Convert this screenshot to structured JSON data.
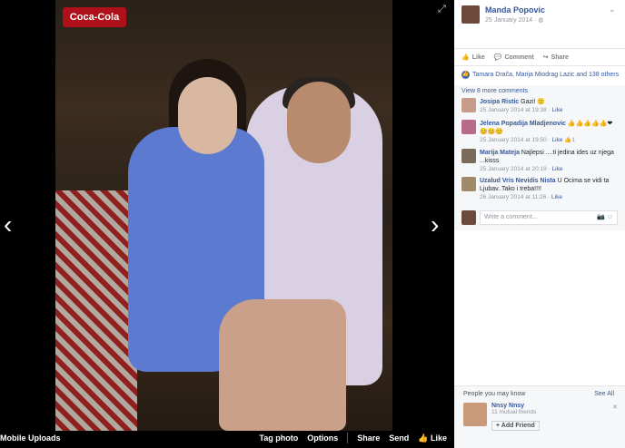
{
  "photo": {
    "sign_text": "Coca-Cola",
    "album": "Mobile Uploads",
    "actions": [
      "Tag photo",
      "Options",
      "Share",
      "Send",
      "Like"
    ]
  },
  "post": {
    "owner": "Manda Popovic",
    "date": "25 January 2014 ·",
    "like": "Like",
    "comment": "Comment",
    "share": "Share",
    "reactions": "Tamara Drača, Marija Miodrag Lazic and 138 others"
  },
  "comments": {
    "view_more": "View 8 more comments",
    "items": [
      {
        "name": "Josipa Ristic",
        "text": "Gazi! 🙂",
        "meta": "25 January 2014 at 19:38 · ",
        "like": "Like",
        "extra": ""
      },
      {
        "name": "Jelena Popadija Mladjenovic",
        "text": "👍👍👍👍👍❤😊😊😊",
        "meta": "25 January 2014 at 19:50 · ",
        "like": "Like",
        "extra": "1"
      },
      {
        "name": "Marija Mateja",
        "text": "Najlepsi ....ti jedina ides uz njega ...kisss",
        "meta": "25 January 2014 at 20:19 · ",
        "like": "Like",
        "extra": ""
      },
      {
        "name": "Uzalud Vris Nevidis Nista",
        "text": "U Ocima se vidi ta Ljubav..Tako i treba!!!!",
        "meta": "26 January 2014 at 11:26 · ",
        "like": "Like",
        "extra": ""
      }
    ],
    "write_placeholder": "Write a comment..."
  },
  "pymk": {
    "title": "People you may know",
    "see_all": "See All",
    "name": "Nnsy Nnsy",
    "mutual": "11 mutual friends",
    "add_friend": "Add Friend"
  },
  "colors": {
    "link": "#365899",
    "meta": "#90949c",
    "brand": "#4267b2"
  }
}
